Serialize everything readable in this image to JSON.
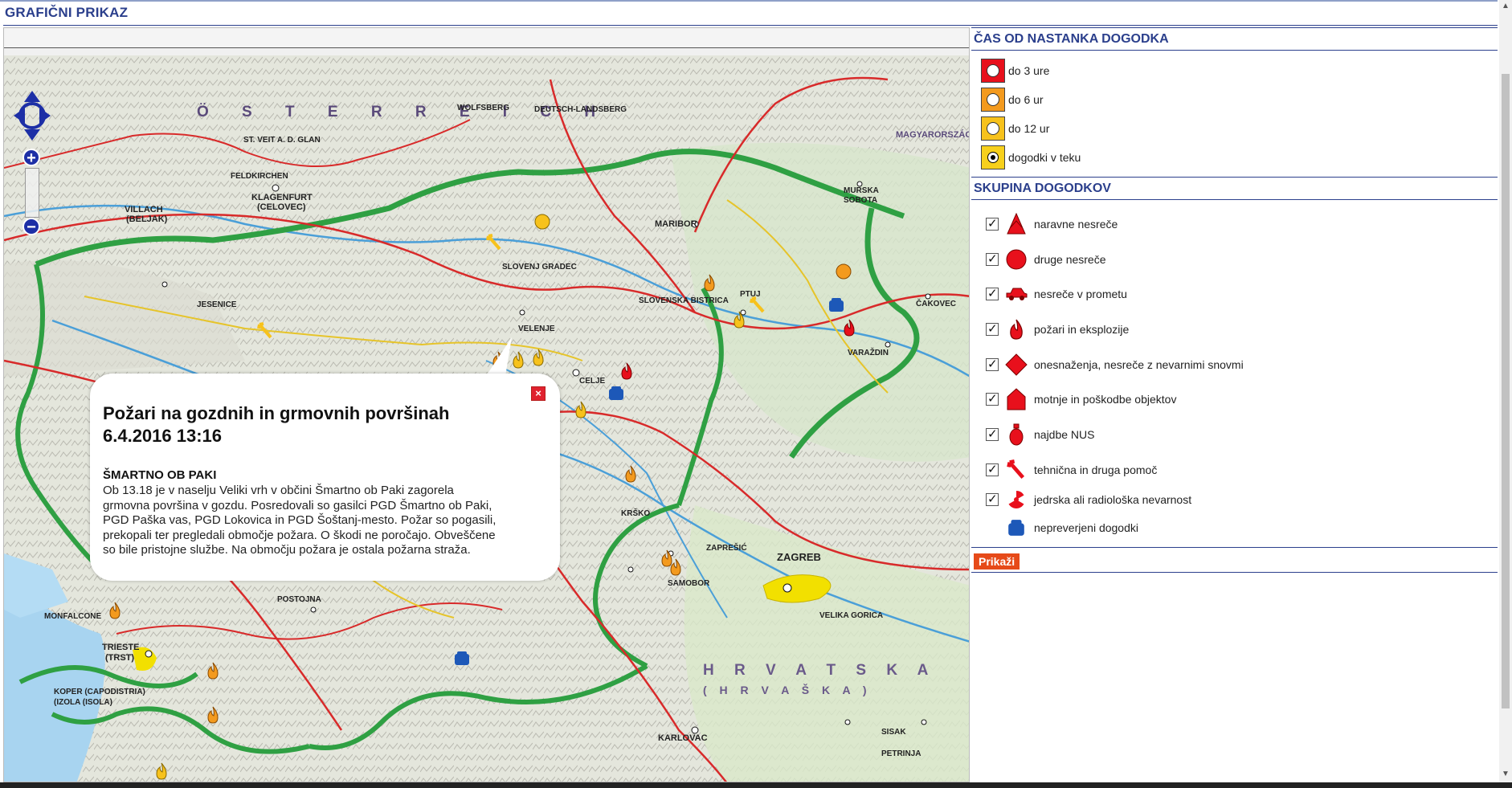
{
  "page": {
    "title": "GRAFIČNI PRIKAZ"
  },
  "map": {
    "labels": {
      "austria": "Ö S T E R R E I C H",
      "hungary": "MAGYARORSZÁG",
      "croatia": "H R V A T S K A",
      "croatia2": "( H R V A Š K A )",
      "klagenfurt": "KLAGENFURT",
      "klagenfurt2": "(CELOVEC)",
      "villach": "VILLACH",
      "villach2": "(BELJAK)",
      "maribor": "MARIBOR",
      "celje": "CELJE",
      "velenje": "VELENJE",
      "zagreb": "ZAGREB",
      "karlovac": "KARLOVAC",
      "trieste": "TRIESTE",
      "trieste2": "(TRST)",
      "koper": "KOPER (CAPODISTRIA)",
      "samobor": "SAMOBOR",
      "jesenice": "JESENICE",
      "ptuj": "PTUJ",
      "varazdin": "VARAŽDIN",
      "cakovec": "ČAKOVEC",
      "murska": "MURSKA",
      "sobota": "SOBOTA",
      "petrinja": "PETRINJA",
      "sisak": "SISAK",
      "velika_gorica": "VELIKA GORICA",
      "postojna": "POSTOJNA",
      "zapresic": "ZAPREŠIĆ",
      "wolfsberg": "WOLFSBERG",
      "stveit": "ST. VEIT A. D. GLAN",
      "feldkirchen": "FELDKIRCHEN",
      "slovenj": "SLOVENJ GRADEC",
      "krsko": "KRŠKO",
      "monfalcone": "MONFALCONE",
      "slovenska": "SLOVENSKA BISTRICA",
      "deutsch": "DEUTSCH-LANDSBERG",
      "izola": "(IZOLA (ISOLA)"
    }
  },
  "popup": {
    "title_line1": "Požari na gozdnih in grmovnih površinah",
    "title_line2": "6.4.2016 13:16",
    "place": "ŠMARTNO OB PAKI",
    "lines": [
      "Ob 13.18 je v naselju Veliki vrh v občini Šmartno ob Paki zagorela",
      "grmovna površina v gozdu. Posredovali so gasilci PGD Šmartno ob Paki,",
      "PGD Paška vas, PGD Lokovica in PGD Šoštanj-mesto. Požar so pogasili,",
      "prekopali ter pregledali območje požara. O škodi ne poročajo. Obveščene",
      "so bile pristojne službe. Na območju požara je ostala požarna straža."
    ]
  },
  "legend": {
    "time_heading": "ČAS OD NASTANKA DOGODKA",
    "time_items": [
      {
        "label": "do 3 ure",
        "color": "#e8101c"
      },
      {
        "label": "do 6 ur",
        "color": "#f39a1e"
      },
      {
        "label": "do 12 ur",
        "color": "#f7c21c"
      },
      {
        "label": "dogodki v teku",
        "color": "#f7d01c"
      }
    ],
    "group_heading": "SKUPINA DOGODKOV",
    "group_items": [
      {
        "label": "naravne nesreče",
        "icon": "tree-icon",
        "checked": true
      },
      {
        "label": "druge nesreče",
        "icon": "circle-icon",
        "checked": true
      },
      {
        "label": "nesreče v prometu",
        "icon": "car-icon",
        "checked": true
      },
      {
        "label": "požari in eksplozije",
        "icon": "fire-icon",
        "checked": true
      },
      {
        "label": "onesnaženja, nesreče z nevarnimi snovmi",
        "icon": "diamond-icon",
        "checked": true
      },
      {
        "label": "motnje in poškodbe objektov",
        "icon": "house-icon",
        "checked": true
      },
      {
        "label": "najdbe NUS",
        "icon": "grenade-icon",
        "checked": true
      },
      {
        "label": "tehnična in druga pomoč",
        "icon": "wrench-icon",
        "checked": true
      },
      {
        "label": "jedrska ali radiološka nevarnost",
        "icon": "radiation-icon",
        "checked": true
      },
      {
        "label": "nepreverjeni dogodki",
        "icon": "phone-icon",
        "checked": false
      }
    ],
    "show_button": "Prikaži"
  },
  "colors": {
    "accent": "#2b3f8c",
    "button": "#e64a19"
  }
}
